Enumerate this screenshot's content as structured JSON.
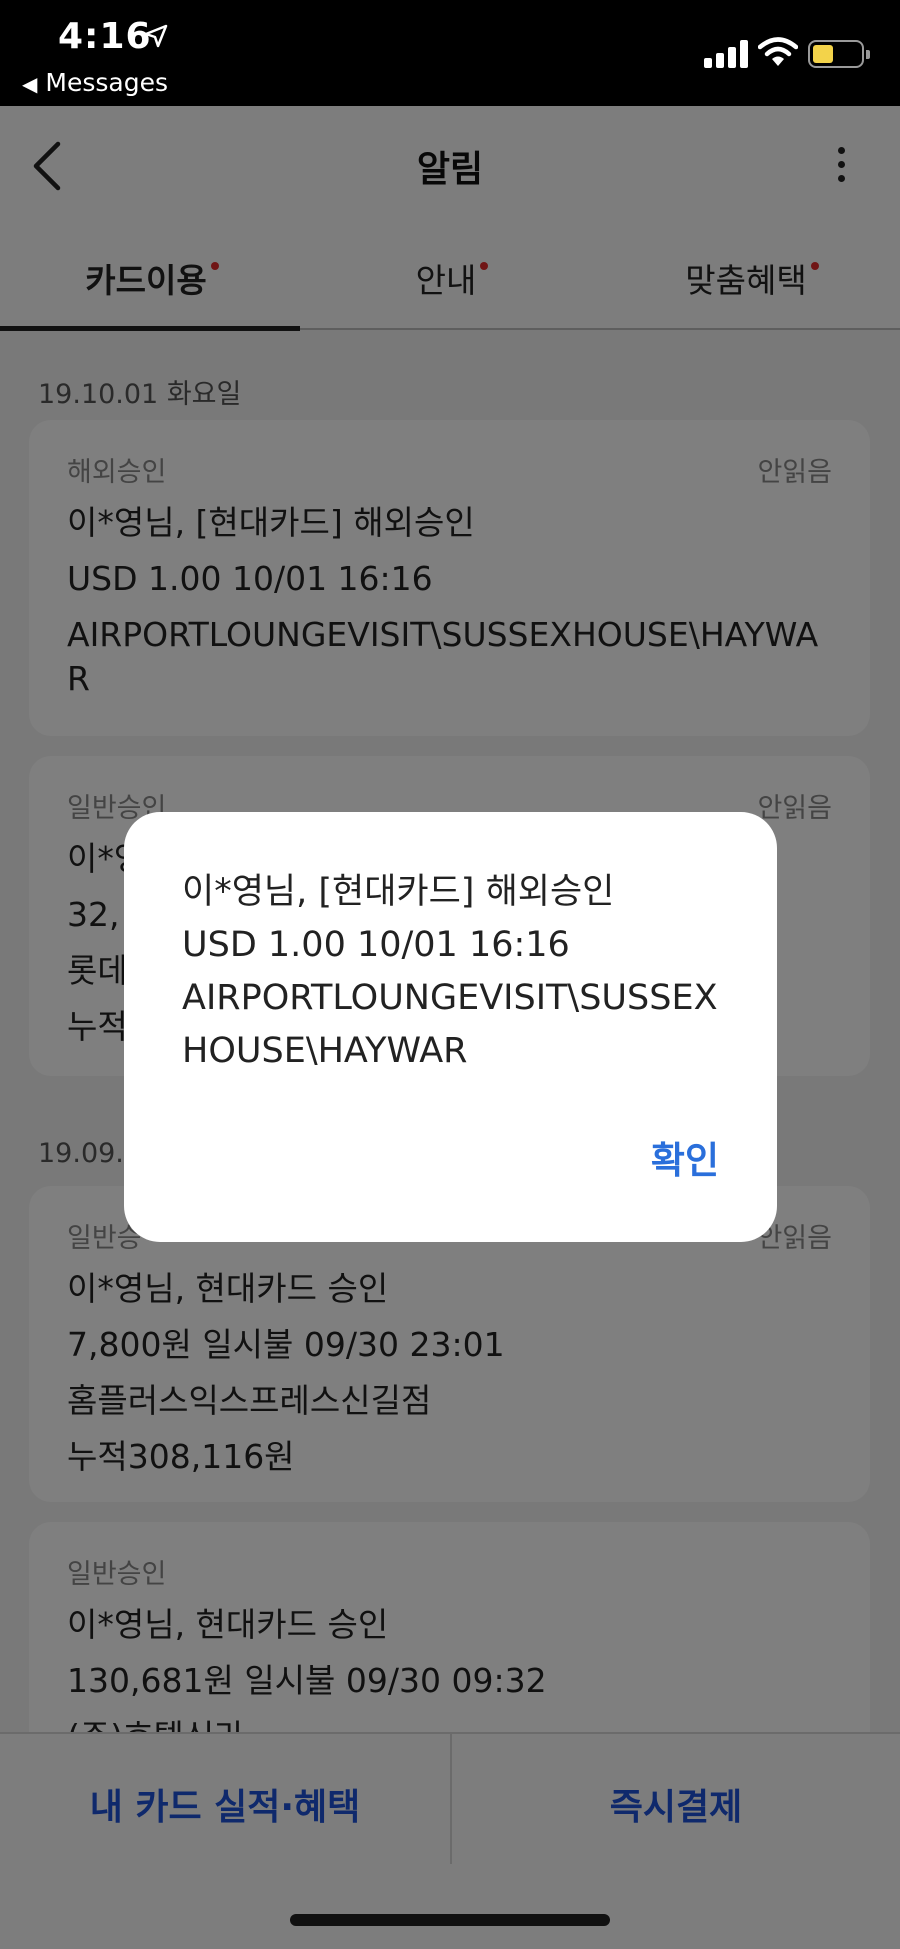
{
  "status_bar": {
    "time": "4:16",
    "back_label": "Messages"
  },
  "header": {
    "title": "알림"
  },
  "tabs": [
    {
      "label": "카드이용",
      "active": true,
      "has_dot": true
    },
    {
      "label": "안내",
      "active": false,
      "has_dot": true
    },
    {
      "label": "맞춤혜택",
      "active": false,
      "has_dot": true
    }
  ],
  "content": {
    "date1": "19.10.01 화요일",
    "date2": "19.09.3",
    "cards": [
      {
        "type": "해외승인",
        "status": "안읽음",
        "lines": [
          "이*영님, [현대카드] 해외승인",
          "USD 1.00 10/01 16:16",
          "AIRPORTLOUNGEVISIT\\SUSSEXHOUSE\\HAYWAR"
        ]
      },
      {
        "type": "일반승인",
        "status": "안읽음",
        "lines": [
          "이*영",
          "32,",
          "롯데",
          "누적"
        ]
      },
      {
        "type": "일반승",
        "status": "안읽음",
        "lines": [
          "이*영님, 현대카드 승인",
          "7,800원 일시불 09/30 23:01",
          "홈플러스익스프레스신길점",
          "누적308,116원"
        ]
      },
      {
        "type": "일반승인",
        "status": "",
        "lines": [
          "이*영님, 현대카드 승인",
          "130,681원 일시불 09/30 09:32",
          "(주)호텔신라"
        ]
      }
    ]
  },
  "bottom_bar": {
    "left_label": "내 카드 실적·혜택",
    "right_label": "즉시결제"
  },
  "dialog": {
    "line1": "이*영님, [현대카드] 해외승인",
    "line2": "USD 1.00 10/01 16:16",
    "line3": "AIRPORTLOUNGEVISIT\\SUSSEXHOUSE\\HAYWAR",
    "confirm_label": "확인"
  },
  "colors": {
    "accent_blue": "#1e52d8",
    "confirm_blue": "#2a6fdb",
    "unread_dot": "#e02b2b",
    "battery": "#f3d34a"
  }
}
